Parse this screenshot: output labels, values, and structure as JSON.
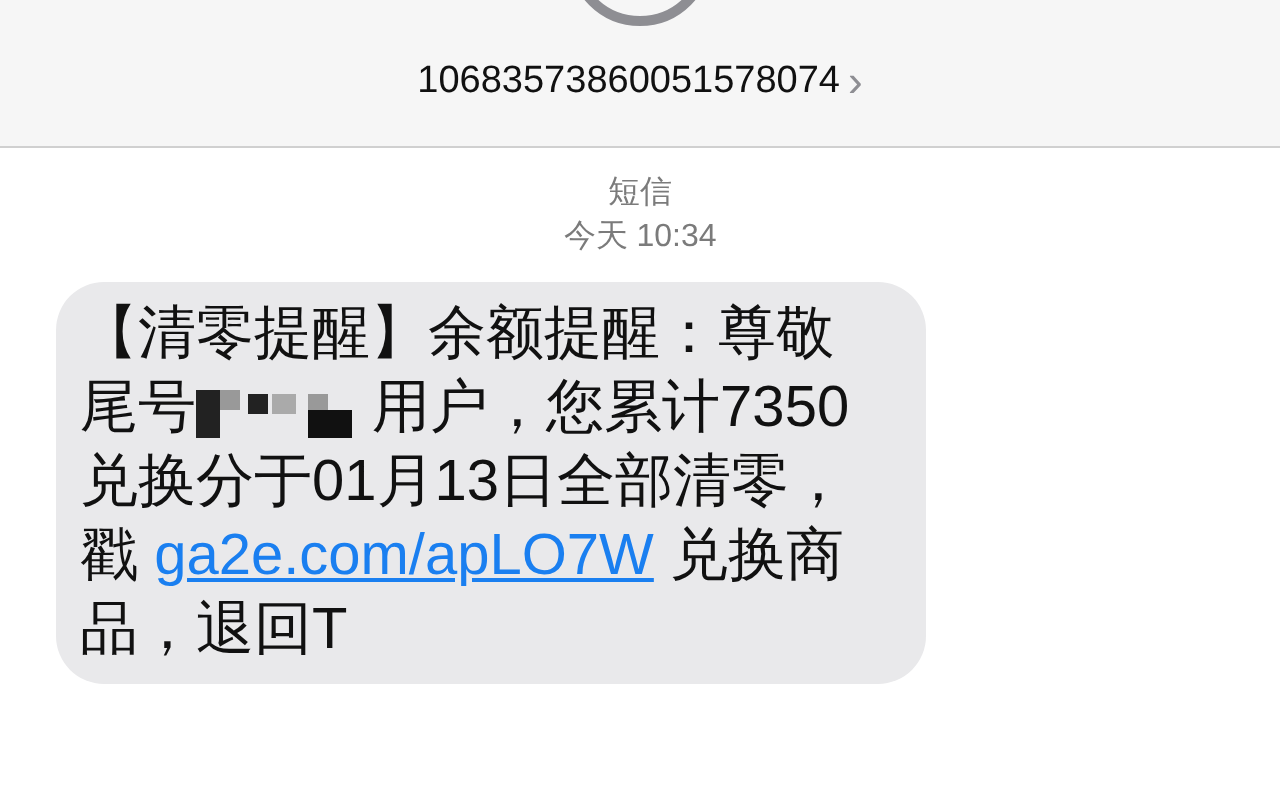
{
  "header": {
    "contact": "10683573860051578074",
    "chevron": "›"
  },
  "thread": {
    "service": "短信",
    "timestamp": "今天 10:34"
  },
  "message": {
    "lines": [
      [
        {
          "kind": "text",
          "text": "【清零提醒】余额提醒：尊敬"
        }
      ],
      [
        {
          "kind": "text",
          "text": "尾号"
        },
        {
          "kind": "redacted"
        },
        {
          "kind": "text",
          "text": " 用户，您累计7350"
        }
      ],
      [
        {
          "kind": "text",
          "text": "兑换分于01月13日全部清零，"
        }
      ],
      [
        {
          "kind": "text",
          "text": "戳 "
        },
        {
          "kind": "link",
          "text": "ga2e.com/apLO7W"
        },
        {
          "kind": "text",
          "text": " 兑换商"
        }
      ],
      [
        {
          "kind": "text",
          "text": "品，退回T"
        }
      ]
    ]
  }
}
